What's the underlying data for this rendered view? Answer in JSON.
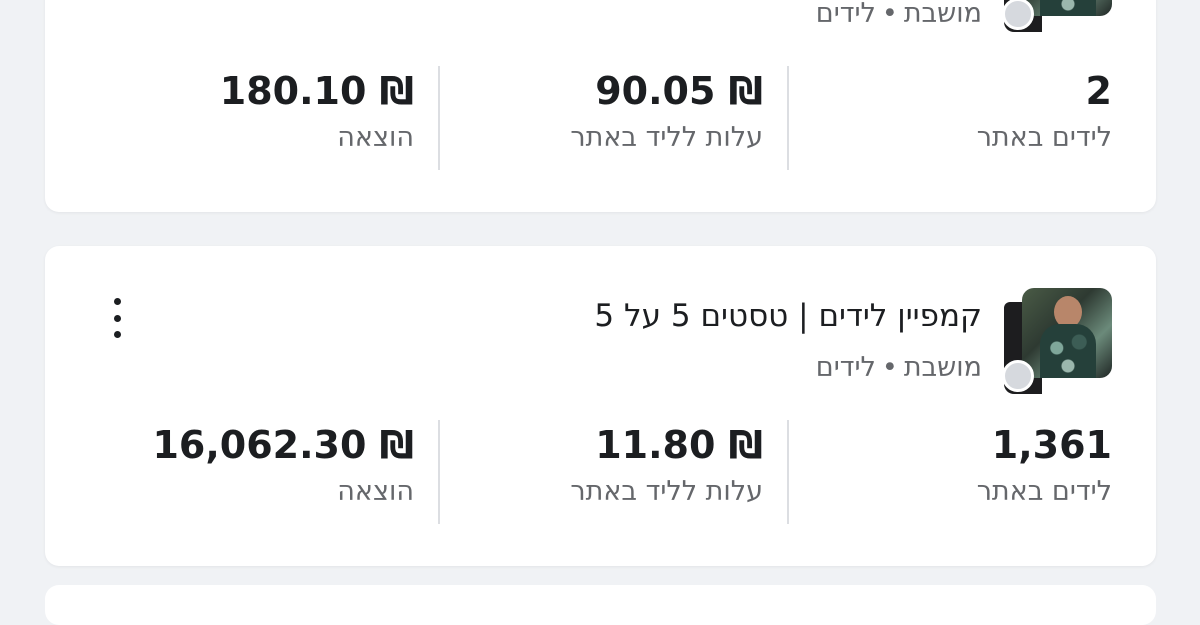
{
  "campaigns": [
    {
      "title": "",
      "subtitle": {
        "status": "מושבת",
        "type": "לידים"
      },
      "metrics": [
        {
          "value": "2",
          "label": "לידים באתר"
        },
        {
          "value": "₪ 90.05",
          "label": "עלות לליד באתר"
        },
        {
          "value": "₪ 180.10",
          "label": "הוצאה"
        }
      ]
    },
    {
      "title": "קמפיין לידים | טסטים 5 על 5",
      "subtitle": {
        "status": "מושבת",
        "type": "לידים"
      },
      "metrics": [
        {
          "value": "1,361",
          "label": "לידים באתר"
        },
        {
          "value": "₪ 11.80",
          "label": "עלות לליד באתר"
        },
        {
          "value": "₪ 16,062.30",
          "label": "הוצאה"
        }
      ]
    }
  ]
}
